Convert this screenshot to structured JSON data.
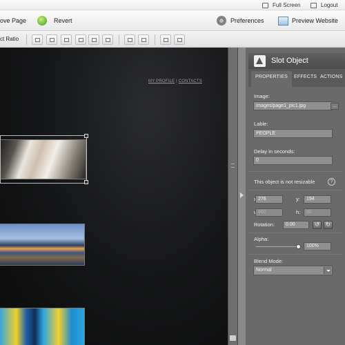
{
  "topbar": {
    "full_screen": "Full Screen",
    "logout": "Logout"
  },
  "toolbar": {
    "save_page": "ove Page",
    "revert": "Revert",
    "preferences": "Preferences",
    "preview_website": "Preview Website"
  },
  "alignbar": {
    "ratio_label": "ct Ratio"
  },
  "canvas": {
    "menu_profile": "MY PROFILE",
    "menu_sep": "|",
    "menu_contacts": "CONTACTS"
  },
  "panel": {
    "title": "Slot Object",
    "tabs": [
      "PROPERTIES",
      "EFFECTS",
      "ACTIONS"
    ],
    "image_label": "Image:",
    "image_value": "images/page1_pic1.jpg",
    "lable_label": "Lable:",
    "lable_value": "PEOPLE",
    "delay_label": "Delay in seconds:",
    "delay_value": "0",
    "resizable_notice": "This object is not resizable",
    "help": "?",
    "x_label": "x:",
    "x_value": "276",
    "y_label": "y:",
    "y_value": "194",
    "w_label": "w:",
    "w_value": "460",
    "h_label": "h:",
    "h_value": "90",
    "rotation_label": "Rotation:",
    "rotation_value": "0.00",
    "alpha_label": "Alpha:",
    "alpha_value": "100%",
    "alpha_fraction": 1.0,
    "blend_label": "Blend Mode:",
    "blend_value": "Normal",
    "browse": "..."
  },
  "colors": {
    "panel_bg": "#6a6a6a",
    "canvas_bg": "#141516"
  }
}
